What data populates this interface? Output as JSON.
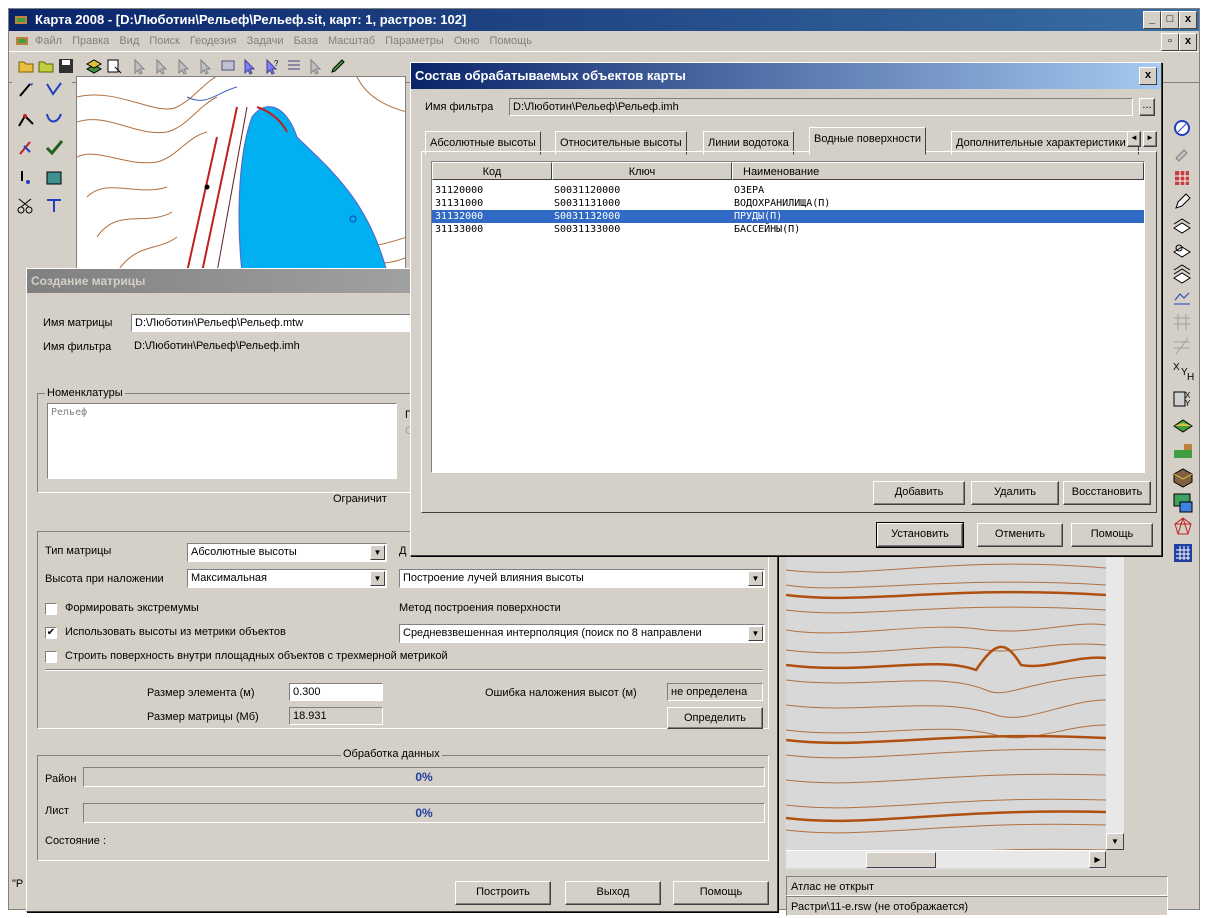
{
  "app": {
    "title": "Карта 2008 - [D:\\Люботин\\Рельеф\\Рельеф.sit, карт: 1, растров: 102]",
    "menu": [
      "Файл",
      "Правка",
      "Вид",
      "Поиск",
      "Геодезия",
      "Задачи",
      "База",
      "Масштаб",
      "Параметры",
      "Окно",
      "Помощь"
    ],
    "min": "_",
    "max": "□",
    "close": "x",
    "restore": "🗗",
    "mdi_close": "x"
  },
  "status": {
    "atlas": "Атлас не открыт",
    "raster": "Растри\\11-е.rsw (не отображается)",
    "left_hint": "\"Р"
  },
  "objects_dialog": {
    "title": "Состав обрабатываемых объектов карты",
    "close": "x",
    "filter_label": "Имя фильтра",
    "filter_value": "D:\\Люботин\\Рельеф\\Рельеф.imh",
    "browse": "...",
    "tabs": [
      "Абсолютные высоты",
      "Относительные высоты",
      "Линии водотока",
      "Водные поверхности",
      "Дополнительные характеристики"
    ],
    "active_tab": 3,
    "columns": [
      "Код",
      "Ключ",
      "Наименование"
    ],
    "rows": [
      {
        "code": "31120000",
        "key": "S0031120000",
        "name": "ОЗЕРА",
        "selected": false
      },
      {
        "code": "31131000",
        "key": "S0031131000",
        "name": "ВОДОХРАНИЛИЩА(П)",
        "selected": false
      },
      {
        "code": "31132000",
        "key": "S0031132000",
        "name": "ПРУДЫ(П)",
        "selected": true
      },
      {
        "code": "31133000",
        "key": "S0031133000",
        "name": "БАССЕЙНЫ(П)",
        "selected": false
      }
    ],
    "btn_add": "Добавить",
    "btn_delete": "Удалить",
    "btn_restore": "Восстановить",
    "btn_set": "Установить",
    "btn_cancel": "Отменить",
    "btn_help": "Помощь",
    "tab_left": "◄",
    "tab_right": "►"
  },
  "matrix_dialog": {
    "title": "Создание матрицы",
    "matrix_name_label": "Имя матрицы",
    "matrix_name_value": "D:\\Люботин\\Рельеф\\Рельеф.mtw",
    "filter_label": "Имя фильтра",
    "filter_value": "D:\\Люботин\\Рельеф\\Рельеф.imh",
    "nomen_label": "Номенклатуры",
    "nomen_value": "Рельеф",
    "side_label_1": "По",
    "side_label_2": "С",
    "limit_label": "Ограничит",
    "type_label": "Тип матрицы",
    "type_value": "Абсолютные высоты",
    "d_label": "Д",
    "height_label": "Высота при наложении",
    "height_value": "Максимальная",
    "rays_value": "Построение лучей влияния высоты",
    "chk_extremes": "Формировать экстремумы",
    "chk_extremes_checked": false,
    "method_label": "Метод построения поверхности",
    "chk_use_heights": "Использовать высоты из метрики объектов",
    "chk_use_heights_checked": true,
    "method_value": "Средневзвешенная интерполяция (поиск по  8 направлени",
    "chk_surface": "Строить поверхность внутри площадных объектов с трехмерной метрикой",
    "chk_surface_checked": false,
    "elem_size_label": "Размер элемента (м)",
    "elem_size_value": "0.300",
    "matrix_size_label": "Размер матрицы (Мб)",
    "matrix_size_value": "18.931",
    "overlay_err_label": "Ошибка наложения высот (м)",
    "overlay_err_value": "не определена",
    "btn_define": "Определить",
    "processing_label": "Обработка данных",
    "region_label": "Район",
    "region_progress": "0%",
    "sheet_label": "Лист",
    "sheet_progress": "0%",
    "state_label": "Состояние :",
    "btn_build": "Построить",
    "btn_exit": "Выход",
    "btn_help": "Помощь"
  }
}
